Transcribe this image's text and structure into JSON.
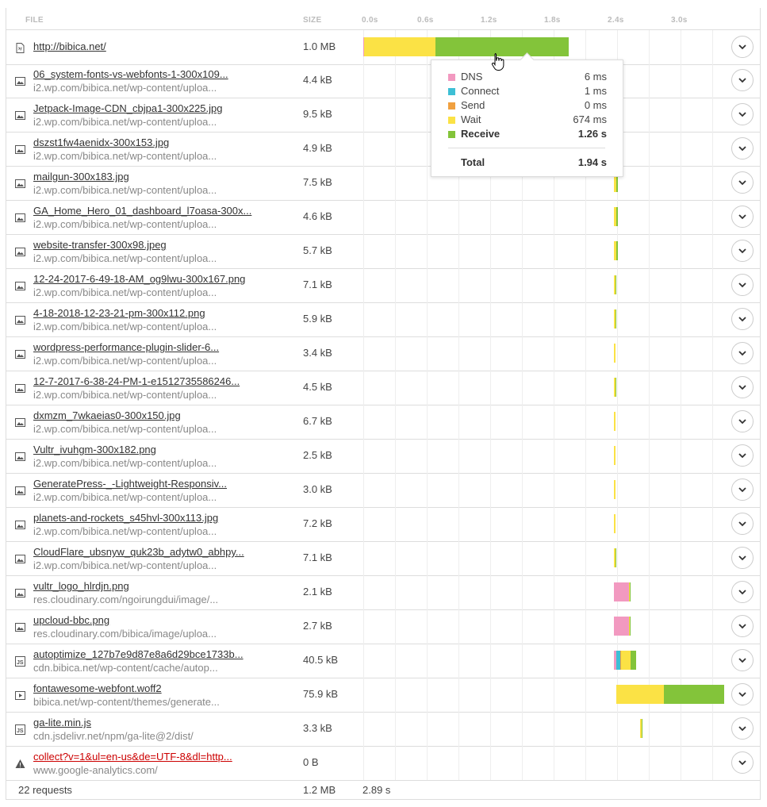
{
  "header": {
    "file": "FILE",
    "size": "SIZE",
    "ticks": [
      "0.0s",
      "0.6s",
      "1.2s",
      "1.8s",
      "2.4s",
      "3.0s"
    ]
  },
  "colors": {
    "dns": "#f299c0",
    "connect": "#3ebfd5",
    "send": "#f0a040",
    "wait": "#fbe245",
    "receive": "#83c43a"
  },
  "rows": [
    {
      "name": "http://bibica.net/",
      "host": "",
      "size": "1.0 MB",
      "icon": "html-file-icon",
      "error": false
    },
    {
      "name": "06_system-fonts-vs-webfonts-1-300x109...",
      "host": "i2.wp.com/bibica.net/wp-content/uploa...",
      "size": "4.4 kB",
      "icon": "image-file-icon",
      "error": false
    },
    {
      "name": "Jetpack-Image-CDN_cbjpa1-300x225.jpg",
      "host": "i2.wp.com/bibica.net/wp-content/uploa...",
      "size": "9.5 kB",
      "icon": "image-file-icon",
      "error": false
    },
    {
      "name": "dszst1fw4aenidx-300x153.jpg",
      "host": "i2.wp.com/bibica.net/wp-content/uploa...",
      "size": "4.9 kB",
      "icon": "image-file-icon",
      "error": false
    },
    {
      "name": "mailgun-300x183.jpg",
      "host": "i2.wp.com/bibica.net/wp-content/uploa...",
      "size": "7.5 kB",
      "icon": "image-file-icon",
      "error": false
    },
    {
      "name": "GA_Home_Hero_01_dashboard_l7oasa-300x...",
      "host": "i2.wp.com/bibica.net/wp-content/uploa...",
      "size": "4.6 kB",
      "icon": "image-file-icon",
      "error": false
    },
    {
      "name": "website-transfer-300x98.jpeg",
      "host": "i2.wp.com/bibica.net/wp-content/uploa...",
      "size": "5.7 kB",
      "icon": "image-file-icon",
      "error": false
    },
    {
      "name": "12-24-2017-6-49-18-AM_og9lwu-300x167.png",
      "host": "i2.wp.com/bibica.net/wp-content/uploa...",
      "size": "7.1 kB",
      "icon": "image-file-icon",
      "error": false
    },
    {
      "name": "4-18-2018-12-23-21-pm-300x112.png",
      "host": "i2.wp.com/bibica.net/wp-content/uploa...",
      "size": "5.9 kB",
      "icon": "image-file-icon",
      "error": false
    },
    {
      "name": "wordpress-performance-plugin-slider-6...",
      "host": "i2.wp.com/bibica.net/wp-content/uploa...",
      "size": "3.4 kB",
      "icon": "image-file-icon",
      "error": false
    },
    {
      "name": "12-7-2017-6-38-24-PM-1-e1512735586246...",
      "host": "i2.wp.com/bibica.net/wp-content/uploa...",
      "size": "4.5 kB",
      "icon": "image-file-icon",
      "error": false
    },
    {
      "name": "dxmzm_7wkaeias0-300x150.jpg",
      "host": "i2.wp.com/bibica.net/wp-content/uploa...",
      "size": "6.7 kB",
      "icon": "image-file-icon",
      "error": false
    },
    {
      "name": "Vultr_ivuhgm-300x182.png",
      "host": "i2.wp.com/bibica.net/wp-content/uploa...",
      "size": "2.5 kB",
      "icon": "image-file-icon",
      "error": false
    },
    {
      "name": "GeneratePress-_-Lightweight-Responsiv...",
      "host": "i2.wp.com/bibica.net/wp-content/uploa...",
      "size": "3.0 kB",
      "icon": "image-file-icon",
      "error": false
    },
    {
      "name": "planets-and-rockets_s45hvl-300x113.jpg",
      "host": "i2.wp.com/bibica.net/wp-content/uploa...",
      "size": "7.2 kB",
      "icon": "image-file-icon",
      "error": false
    },
    {
      "name": "CloudFlare_ubsnyw_quk23b_adytw0_abhpy...",
      "host": "i2.wp.com/bibica.net/wp-content/uploa...",
      "size": "7.1 kB",
      "icon": "image-file-icon",
      "error": false
    },
    {
      "name": "vultr_logo_hlrdjn.png",
      "host": "res.cloudinary.com/ngoirungdui/image/...",
      "size": "2.1 kB",
      "icon": "image-file-icon",
      "error": false
    },
    {
      "name": "upcloud-bbc.png",
      "host": "res.cloudinary.com/bibica/image/uploa...",
      "size": "2.7 kB",
      "icon": "image-file-icon",
      "error": false
    },
    {
      "name": "autoptimize_127b7e9d87e8a6d29bce1733b...",
      "host": "cdn.bibica.net/wp-content/cache/autop...",
      "size": "40.5 kB",
      "icon": "js-file-icon",
      "error": false
    },
    {
      "name": "fontawesome-webfont.woff2",
      "host": "bibica.net/wp-content/themes/generate...",
      "size": "75.9 kB",
      "icon": "font-file-icon",
      "error": false
    },
    {
      "name": "ga-lite.min.js",
      "host": "cdn.jsdelivr.net/npm/ga-lite@2/dist/",
      "size": "3.3 kB",
      "icon": "js-file-icon",
      "error": false
    },
    {
      "name": "collect?v=1&ul=en-us&de=UTF-8&dl=http...",
      "host": "www.google-analytics.com/",
      "size": "0 B",
      "icon": "warning-icon",
      "error": true
    }
  ],
  "timings": [
    {
      "dns": 0.006,
      "connect": 0.001,
      "send": 0,
      "start": 0.0,
      "wait": 0.674,
      "receive": 1.26
    },
    {
      "start": 2.37,
      "dns": 0,
      "connect": 0,
      "send": 0,
      "wait": 0.02,
      "receive": 0.015
    },
    {
      "start": 2.37,
      "dns": 0,
      "connect": 0,
      "send": 0,
      "wait": 0.02,
      "receive": 0.015
    },
    {
      "start": 2.37,
      "dns": 0,
      "connect": 0,
      "send": 0,
      "wait": 0.02,
      "receive": 0.015
    },
    {
      "start": 2.37,
      "dns": 0,
      "connect": 0,
      "send": 0,
      "wait": 0.02,
      "receive": 0.015
    },
    {
      "start": 2.37,
      "dns": 0,
      "connect": 0,
      "send": 0,
      "wait": 0.02,
      "receive": 0.015
    },
    {
      "start": 2.37,
      "dns": 0,
      "connect": 0,
      "send": 0,
      "wait": 0.02,
      "receive": 0.015
    },
    {
      "start": 2.37,
      "dns": 0,
      "connect": 0,
      "send": 0,
      "wait": 0.012,
      "receive": 0.008
    },
    {
      "start": 2.37,
      "dns": 0,
      "connect": 0,
      "send": 0,
      "wait": 0.012,
      "receive": 0.008
    },
    {
      "start": 2.37,
      "dns": 0,
      "connect": 0,
      "send": 0,
      "wait": 0.012,
      "receive": 0
    },
    {
      "start": 2.37,
      "dns": 0,
      "connect": 0,
      "send": 0,
      "wait": 0.012,
      "receive": 0.008
    },
    {
      "start": 2.37,
      "dns": 0,
      "connect": 0,
      "send": 0,
      "wait": 0.012,
      "receive": 0
    },
    {
      "start": 2.37,
      "dns": 0,
      "connect": 0,
      "send": 0,
      "wait": 0.012,
      "receive": 0
    },
    {
      "start": 2.37,
      "dns": 0,
      "connect": 0,
      "send": 0,
      "wait": 0.012,
      "receive": 0
    },
    {
      "start": 2.37,
      "dns": 0,
      "connect": 0,
      "send": 0,
      "wait": 0.012,
      "receive": 0
    },
    {
      "start": 2.37,
      "dns": 0,
      "connect": 0,
      "send": 0,
      "wait": 0.012,
      "receive": 0.008
    },
    {
      "start": 2.37,
      "dns": 0.14,
      "connect": 0,
      "send": 0,
      "wait": 0.008,
      "receive": 0.008
    },
    {
      "start": 2.37,
      "dns": 0.14,
      "connect": 0,
      "send": 0,
      "wait": 0.008,
      "receive": 0.008
    },
    {
      "start": 2.37,
      "dns": 0.02,
      "connect": 0.04,
      "send": 0.01,
      "wait": 0.09,
      "receive": 0.05
    },
    {
      "start": 2.39,
      "dns": 0,
      "connect": 0,
      "send": 0,
      "wait": 0.45,
      "receive": 0.57
    },
    {
      "start": 2.62,
      "dns": 0,
      "connect": 0,
      "send": 0,
      "wait": 0.01,
      "receive": 0.01
    },
    {
      "start": 0,
      "dns": 0,
      "connect": 0,
      "send": 0,
      "wait": 0,
      "receive": 0
    }
  ],
  "tooltip": {
    "items": [
      {
        "label": "DNS",
        "value": "6 ms",
        "key": "dns"
      },
      {
        "label": "Connect",
        "value": "1 ms",
        "key": "connect"
      },
      {
        "label": "Send",
        "value": "0 ms",
        "key": "send"
      },
      {
        "label": "Wait",
        "value": "674 ms",
        "key": "wait"
      },
      {
        "label": "Receive",
        "value": "1.26 s",
        "key": "receive"
      }
    ],
    "total_label": "Total",
    "total_value": "1.94 s"
  },
  "footer": {
    "requests": "22 requests",
    "size": "1.2 MB",
    "time": "2.89 s"
  }
}
